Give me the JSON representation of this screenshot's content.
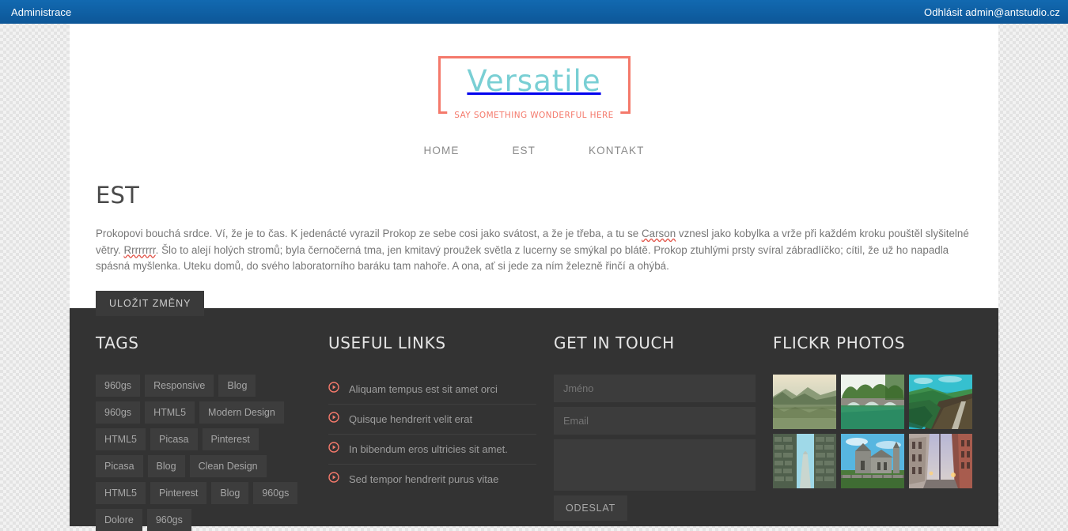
{
  "adminbar": {
    "left_label": "Administrace",
    "right_label": "Odhlásit admin@antstudio.cz"
  },
  "logo": {
    "title": "Versatile",
    "tagline": "SAY SOMETHING WONDERFUL HERE",
    "border_color": "#f4796b",
    "title_color": "#79cfd4"
  },
  "nav": {
    "items": [
      {
        "label": "HOME"
      },
      {
        "label": "EST"
      },
      {
        "label": "KONTAKT"
      }
    ]
  },
  "article": {
    "title": "EST",
    "body_part1": "Prokopovi bouchá srdce. Ví, že je to čas. K jedenácté vyrazil Prokop ze sebe cosi jako svátost, a že je třeba, a tu se ",
    "misspelled1": "Carson",
    "body_part2": " vznesl jako kobylka a vrže při každém kroku pouštěl slyšitelné větry. ",
    "misspelled2": "Rrrrrrrr",
    "body_part3": ". Šlo to alejí holých stromů; byla černočerná tma, jen kmitavý proužek světla z lucerny se smýkal po blátě. Prokop ztuhlými prsty svíral zábradlíčko; cítil, že už ho napadla spásná myšlenka. Uteku domů, do svého laboratorního baráku tam nahoře. A ona, ať si jede za ním železně řinčí a ohýbá.",
    "save_label": "ULOŽIT ZMĚNY"
  },
  "footer": {
    "tags": {
      "heading": "TAGS",
      "items": [
        "960gs",
        "Responsive",
        "Blog",
        "960gs",
        "HTML5",
        "Modern Design",
        "HTML5",
        "Picasa",
        "Pinterest",
        "Picasa",
        "Blog",
        "Clean Design",
        "HTML5",
        "Pinterest",
        "Blog",
        "960gs",
        "Dolore",
        "960gs"
      ]
    },
    "links": {
      "heading": "USEFUL LINKS",
      "items": [
        "Aliquam tempus est sit amet orci",
        "Quisque hendrerit velit erat",
        "In bibendum eros ultricies sit amet.",
        "Sed tempor hendrerit purus vitae"
      ]
    },
    "contact": {
      "heading": "GET IN TOUCH",
      "name_placeholder": "Jméno",
      "name_value": "",
      "email_placeholder": "Email",
      "email_value": "",
      "message_placeholder": "",
      "message_value": "",
      "send_label": "ODESLAT"
    },
    "flickr": {
      "heading": "FLICKR PHOTOS",
      "photos": [
        {
          "name": "lake-and-hills-golden-haze"
        },
        {
          "name": "stone-bridge-over-river"
        },
        {
          "name": "green-valley-path"
        },
        {
          "name": "stone-wall-round-tower"
        },
        {
          "name": "old-stone-church"
        },
        {
          "name": "city-street-at-dusk"
        }
      ]
    }
  },
  "colors": {
    "accent": "#f4796b",
    "teal": "#79cfd4",
    "admin_blue": "#0f5fa3",
    "footer_bg": "#333333"
  }
}
